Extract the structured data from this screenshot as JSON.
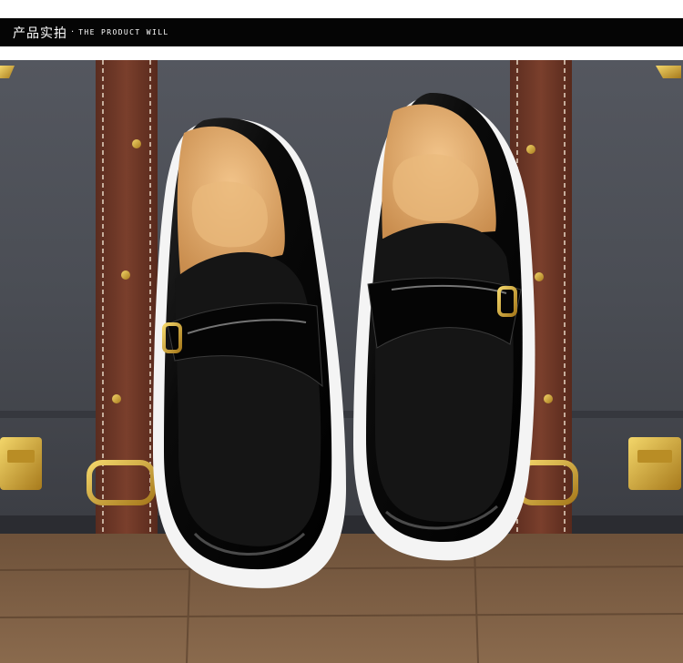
{
  "header": {
    "title_cn": "产品实拍",
    "separator": "·",
    "subtitle_en": "THE PRODUCT WILL"
  },
  "photo": {
    "subject": "black-loafers-on-suitcase",
    "colors": {
      "header_bg": "#050505",
      "suitcase": "#4a4d54",
      "strap": "#6b3526",
      "floor": "#7a5c42",
      "shoe_leather": "#0b0b0b",
      "sole": "#f4f4f4",
      "insole": "#e0ab6a",
      "hardware": "#c9a23a"
    }
  }
}
